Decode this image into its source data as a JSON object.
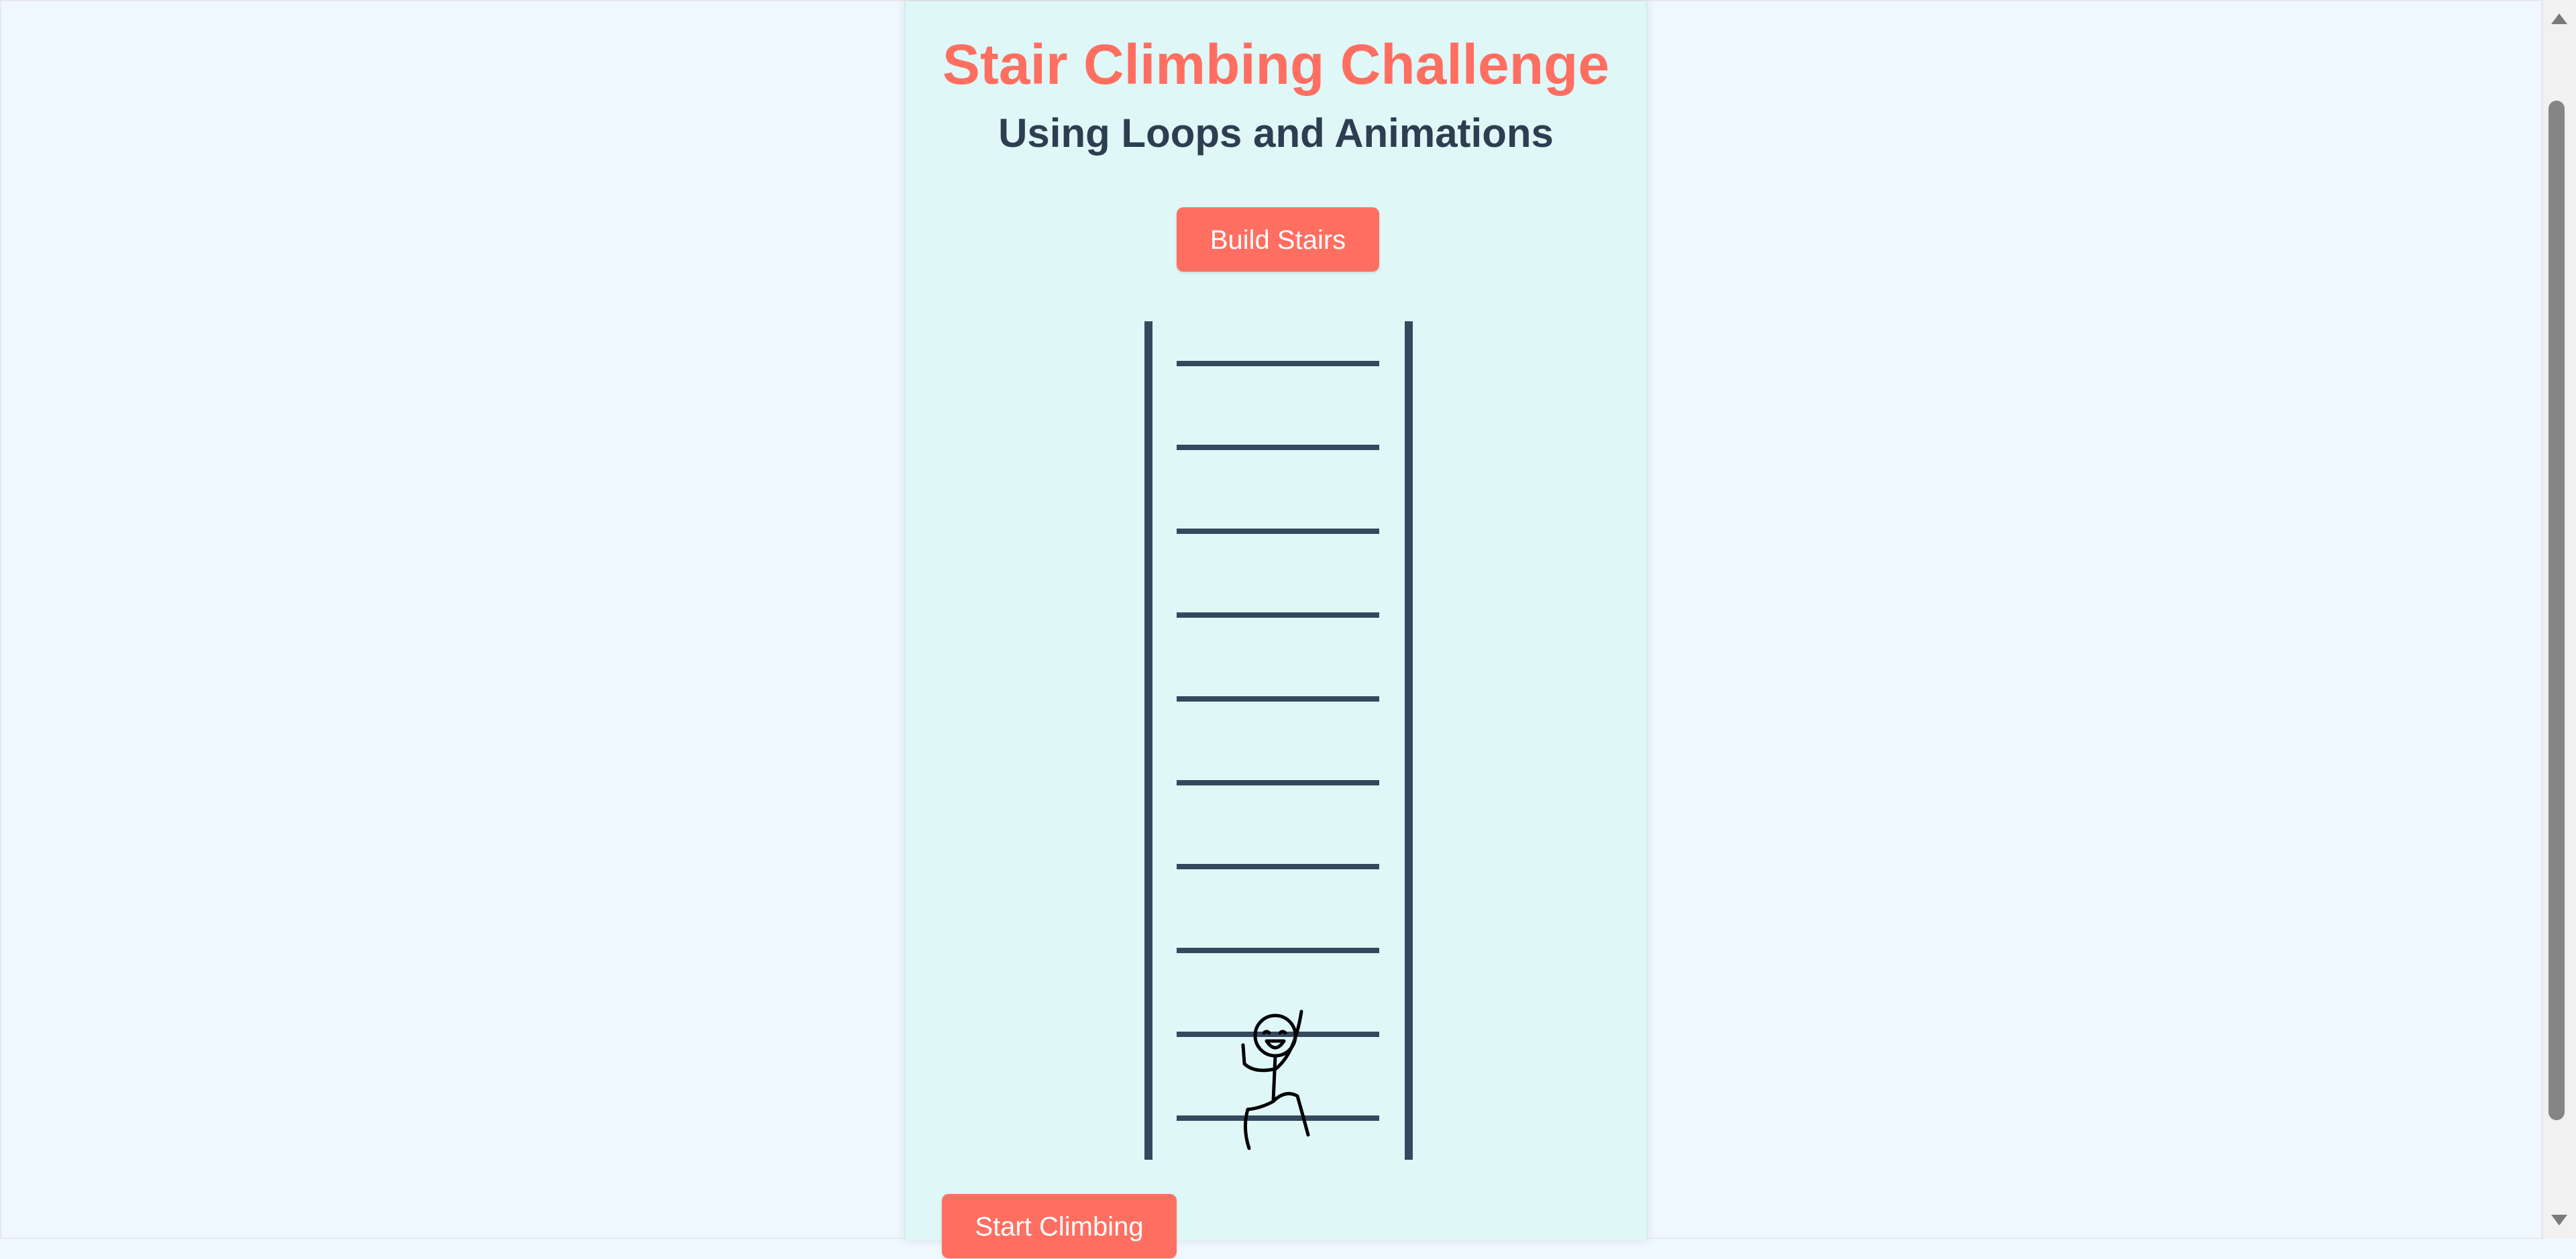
{
  "page": {
    "title": "Stair Climbing Challenge",
    "subtitle": "Using Loops and Animations"
  },
  "controls": {
    "build_label": "Build Stairs",
    "start_label": "Start Climbing"
  },
  "ladder": {
    "rung_count": 10,
    "climber_on_rung": 2
  },
  "colors": {
    "accent": "#ff6f61",
    "heading": "#2c3e50",
    "ladder": "#34495e",
    "card_bg": "#e0f7f8",
    "page_bg": "#f0f8ff"
  }
}
